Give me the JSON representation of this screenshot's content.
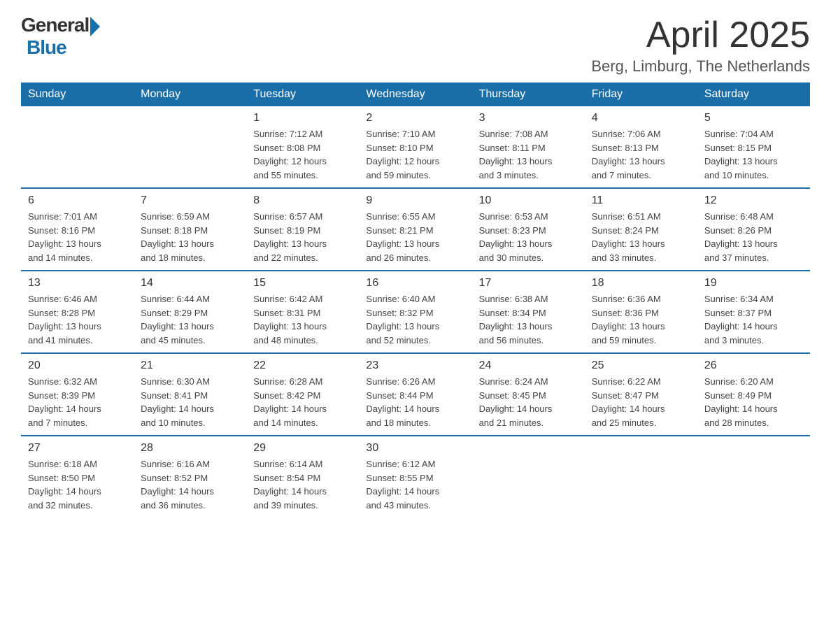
{
  "logo": {
    "general": "General",
    "blue": "Blue"
  },
  "title": "April 2025",
  "location": "Berg, Limburg, The Netherlands",
  "headers": [
    "Sunday",
    "Monday",
    "Tuesday",
    "Wednesday",
    "Thursday",
    "Friday",
    "Saturday"
  ],
  "weeks": [
    [
      {
        "day": "",
        "info": ""
      },
      {
        "day": "",
        "info": ""
      },
      {
        "day": "1",
        "info": "Sunrise: 7:12 AM\nSunset: 8:08 PM\nDaylight: 12 hours\nand 55 minutes."
      },
      {
        "day": "2",
        "info": "Sunrise: 7:10 AM\nSunset: 8:10 PM\nDaylight: 12 hours\nand 59 minutes."
      },
      {
        "day": "3",
        "info": "Sunrise: 7:08 AM\nSunset: 8:11 PM\nDaylight: 13 hours\nand 3 minutes."
      },
      {
        "day": "4",
        "info": "Sunrise: 7:06 AM\nSunset: 8:13 PM\nDaylight: 13 hours\nand 7 minutes."
      },
      {
        "day": "5",
        "info": "Sunrise: 7:04 AM\nSunset: 8:15 PM\nDaylight: 13 hours\nand 10 minutes."
      }
    ],
    [
      {
        "day": "6",
        "info": "Sunrise: 7:01 AM\nSunset: 8:16 PM\nDaylight: 13 hours\nand 14 minutes."
      },
      {
        "day": "7",
        "info": "Sunrise: 6:59 AM\nSunset: 8:18 PM\nDaylight: 13 hours\nand 18 minutes."
      },
      {
        "day": "8",
        "info": "Sunrise: 6:57 AM\nSunset: 8:19 PM\nDaylight: 13 hours\nand 22 minutes."
      },
      {
        "day": "9",
        "info": "Sunrise: 6:55 AM\nSunset: 8:21 PM\nDaylight: 13 hours\nand 26 minutes."
      },
      {
        "day": "10",
        "info": "Sunrise: 6:53 AM\nSunset: 8:23 PM\nDaylight: 13 hours\nand 30 minutes."
      },
      {
        "day": "11",
        "info": "Sunrise: 6:51 AM\nSunset: 8:24 PM\nDaylight: 13 hours\nand 33 minutes."
      },
      {
        "day": "12",
        "info": "Sunrise: 6:48 AM\nSunset: 8:26 PM\nDaylight: 13 hours\nand 37 minutes."
      }
    ],
    [
      {
        "day": "13",
        "info": "Sunrise: 6:46 AM\nSunset: 8:28 PM\nDaylight: 13 hours\nand 41 minutes."
      },
      {
        "day": "14",
        "info": "Sunrise: 6:44 AM\nSunset: 8:29 PM\nDaylight: 13 hours\nand 45 minutes."
      },
      {
        "day": "15",
        "info": "Sunrise: 6:42 AM\nSunset: 8:31 PM\nDaylight: 13 hours\nand 48 minutes."
      },
      {
        "day": "16",
        "info": "Sunrise: 6:40 AM\nSunset: 8:32 PM\nDaylight: 13 hours\nand 52 minutes."
      },
      {
        "day": "17",
        "info": "Sunrise: 6:38 AM\nSunset: 8:34 PM\nDaylight: 13 hours\nand 56 minutes."
      },
      {
        "day": "18",
        "info": "Sunrise: 6:36 AM\nSunset: 8:36 PM\nDaylight: 13 hours\nand 59 minutes."
      },
      {
        "day": "19",
        "info": "Sunrise: 6:34 AM\nSunset: 8:37 PM\nDaylight: 14 hours\nand 3 minutes."
      }
    ],
    [
      {
        "day": "20",
        "info": "Sunrise: 6:32 AM\nSunset: 8:39 PM\nDaylight: 14 hours\nand 7 minutes."
      },
      {
        "day": "21",
        "info": "Sunrise: 6:30 AM\nSunset: 8:41 PM\nDaylight: 14 hours\nand 10 minutes."
      },
      {
        "day": "22",
        "info": "Sunrise: 6:28 AM\nSunset: 8:42 PM\nDaylight: 14 hours\nand 14 minutes."
      },
      {
        "day": "23",
        "info": "Sunrise: 6:26 AM\nSunset: 8:44 PM\nDaylight: 14 hours\nand 18 minutes."
      },
      {
        "day": "24",
        "info": "Sunrise: 6:24 AM\nSunset: 8:45 PM\nDaylight: 14 hours\nand 21 minutes."
      },
      {
        "day": "25",
        "info": "Sunrise: 6:22 AM\nSunset: 8:47 PM\nDaylight: 14 hours\nand 25 minutes."
      },
      {
        "day": "26",
        "info": "Sunrise: 6:20 AM\nSunset: 8:49 PM\nDaylight: 14 hours\nand 28 minutes."
      }
    ],
    [
      {
        "day": "27",
        "info": "Sunrise: 6:18 AM\nSunset: 8:50 PM\nDaylight: 14 hours\nand 32 minutes."
      },
      {
        "day": "28",
        "info": "Sunrise: 6:16 AM\nSunset: 8:52 PM\nDaylight: 14 hours\nand 36 minutes."
      },
      {
        "day": "29",
        "info": "Sunrise: 6:14 AM\nSunset: 8:54 PM\nDaylight: 14 hours\nand 39 minutes."
      },
      {
        "day": "30",
        "info": "Sunrise: 6:12 AM\nSunset: 8:55 PM\nDaylight: 14 hours\nand 43 minutes."
      },
      {
        "day": "",
        "info": ""
      },
      {
        "day": "",
        "info": ""
      },
      {
        "day": "",
        "info": ""
      }
    ]
  ]
}
